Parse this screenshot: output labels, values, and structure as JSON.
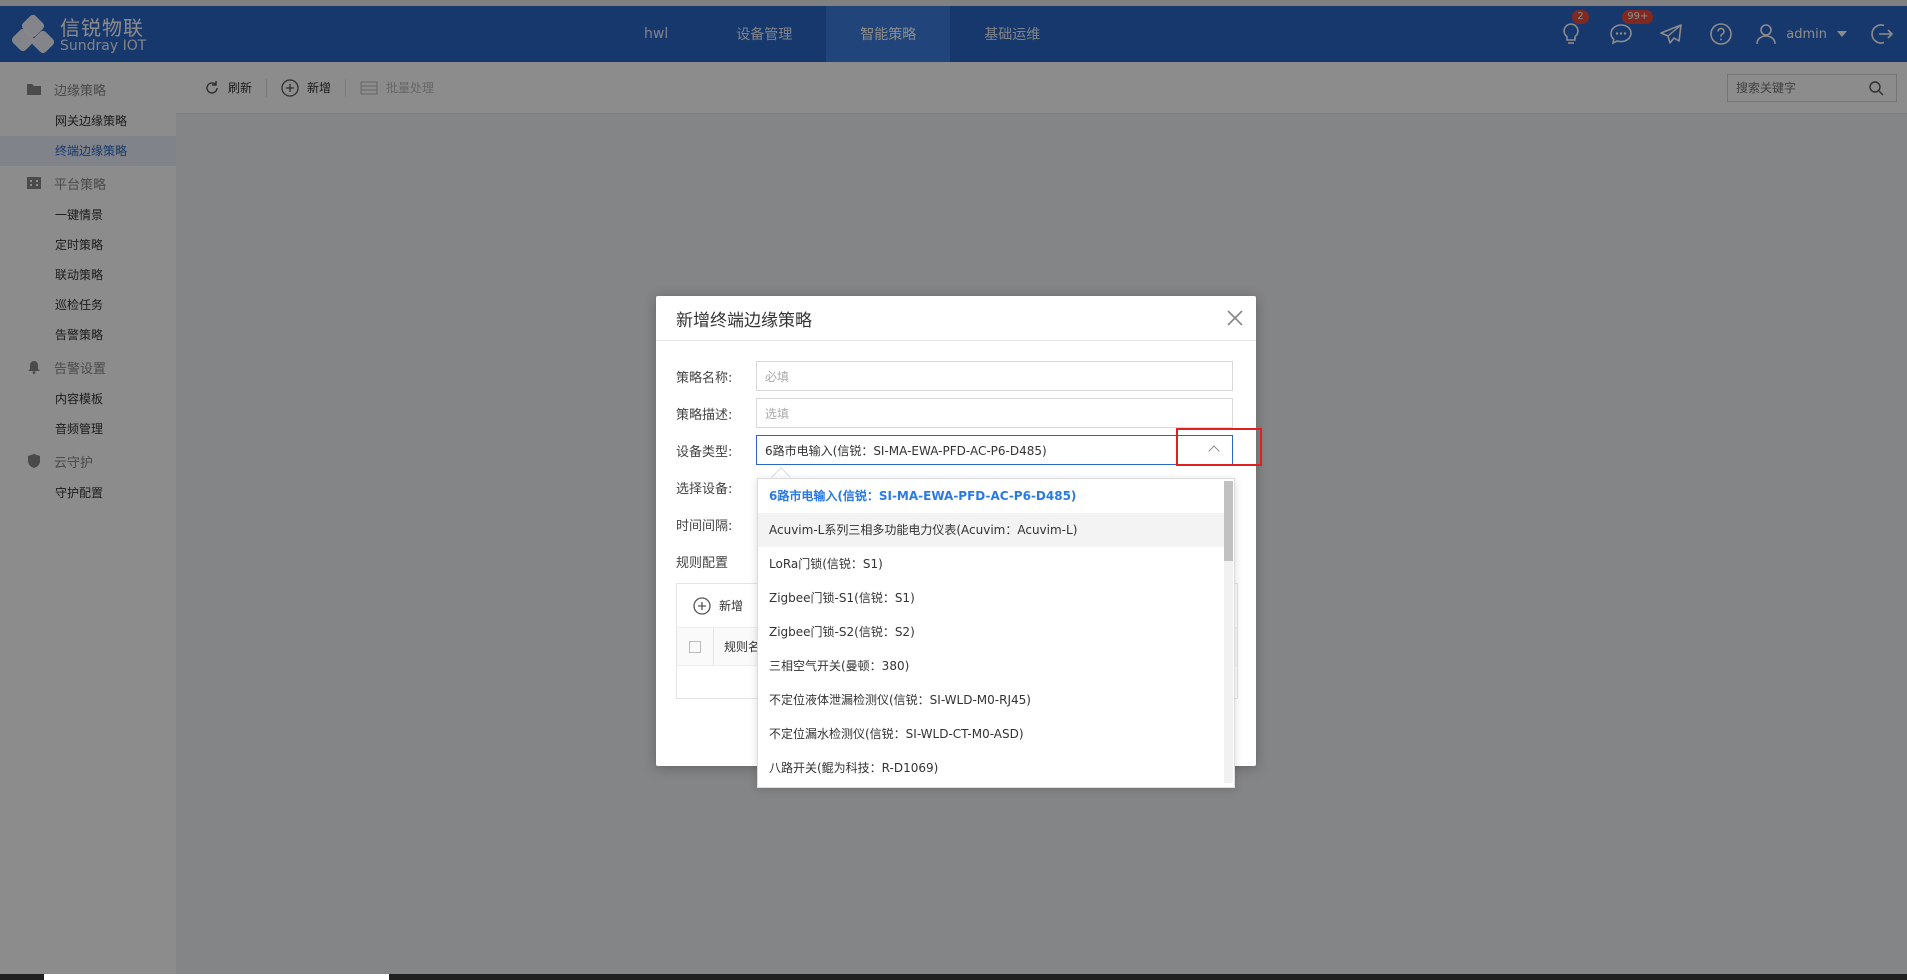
{
  "brand": {
    "name_cn": "信锐物联",
    "name_en": "Sundray IOT"
  },
  "nav": [
    {
      "label": "hwl",
      "active": false
    },
    {
      "label": "设备管理",
      "active": false
    },
    {
      "label": "智能策略",
      "active": true
    },
    {
      "label": "基础运维",
      "active": false
    }
  ],
  "top_icons": {
    "bulb_badge": "2",
    "message_badge": "99+",
    "user_name": "admin"
  },
  "sidebar": {
    "groups": [
      {
        "label": "边缘策略",
        "icon": "folder-icon",
        "items": [
          {
            "label": "网关边缘策略",
            "active": false
          },
          {
            "label": "终端边缘策略",
            "active": true
          }
        ]
      },
      {
        "label": "平台策略",
        "icon": "building-icon",
        "items": [
          {
            "label": "一键情景",
            "active": false
          },
          {
            "label": "定时策略",
            "active": false
          },
          {
            "label": "联动策略",
            "active": false
          },
          {
            "label": "巡检任务",
            "active": false
          },
          {
            "label": "告警策略",
            "active": false
          }
        ]
      },
      {
        "label": "告警设置",
        "icon": "bell-icon",
        "items": [
          {
            "label": "内容模板",
            "active": false
          },
          {
            "label": "音频管理",
            "active": false
          }
        ]
      },
      {
        "label": "云守护",
        "icon": "shield-icon",
        "items": [
          {
            "label": "守护配置",
            "active": false
          }
        ]
      }
    ]
  },
  "toolbar": {
    "refresh_label": "刷新",
    "add_label": "新增",
    "batch_label": "批量处理",
    "search_placeholder": "搜索关键字"
  },
  "dialog": {
    "title": "新增终端边缘策略",
    "fields": {
      "name_label": "策略名称:",
      "name_placeholder": "必填",
      "desc_label": "策略描述:",
      "desc_placeholder": "选填",
      "type_label": "设备类型:",
      "type_value": "6路市电输入(信锐：SI-MA-EWA-PFD-AC-P6-D485)",
      "device_label": "选择设备:",
      "interval_label": "时间间隔:",
      "rule_label": "规则配置"
    },
    "rule_add_label": "新增",
    "rule_col_name": "规则名"
  },
  "dropdown": {
    "options": [
      {
        "label": "6路市电输入(信锐：SI-MA-EWA-PFD-AC-P6-D485)",
        "state": "selected"
      },
      {
        "label": "Acuvim-L系列三相多功能电力仪表(Acuvim：Acuvim-L)",
        "state": "hover"
      },
      {
        "label": "LoRa门锁(信锐：S1)",
        "state": ""
      },
      {
        "label": "Zigbee门锁-S1(信锐：S1)",
        "state": ""
      },
      {
        "label": "Zigbee门锁-S2(信锐：S2)",
        "state": ""
      },
      {
        "label": "三相空气开关(曼顿：380)",
        "state": ""
      },
      {
        "label": "不定位液体泄漏检测仪(信锐：SI-WLD-M0-RJ45)",
        "state": ""
      },
      {
        "label": "不定位漏水检测仪(信锐：SI-WLD-CT-M0-ASD)",
        "state": ""
      },
      {
        "label": "八路开关(鲲为科技：R-D1069)",
        "state": ""
      }
    ]
  },
  "colors": {
    "brand_blue": "#2a66c5",
    "selected_option": "#2a7ae2",
    "highlight_box": "#e02020"
  }
}
